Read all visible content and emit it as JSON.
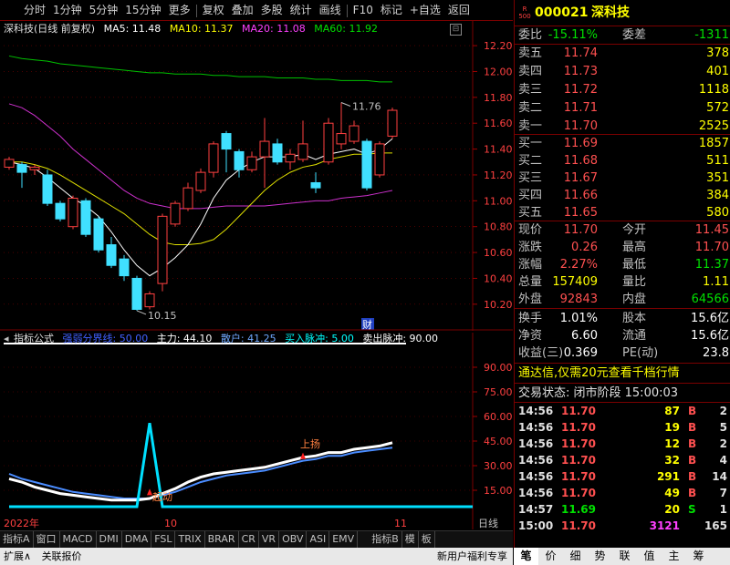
{
  "toolbar": {
    "items": [
      "分时",
      "1分钟",
      "5分钟",
      "15分钟",
      "更多",
      "复权",
      "叠加",
      "多股",
      "统计",
      "画线",
      "F10",
      "标记",
      "+自选",
      "返回"
    ]
  },
  "chart": {
    "stock_title": "深科技(日线 前复权)",
    "ma5": "MA5: 11.48",
    "ma10": "MA10: 11.37",
    "ma20": "MA20: 11.08",
    "ma60": "MA60: 11.92",
    "price_ticks": [
      "12.20",
      "12.00",
      "11.80",
      "11.60",
      "11.40",
      "11.20",
      "11.00",
      "10.80",
      "10.60",
      "10.40",
      "10.20"
    ],
    "high_label": "11.76",
    "low_label": "10.15",
    "cai_marker": "财",
    "date_labels": [
      "2022年",
      "10",
      "11"
    ],
    "period_label": "日线"
  },
  "indicator": {
    "name": "指标公式",
    "strength": "强弱分界线: 50.00",
    "main_force": "主力: 44.10",
    "retail": "散户: 41.25",
    "buy_pulse": "买入脉冲: 5.00",
    "sell_pulse": "卖出脉冲: 90.00",
    "ticks": [
      "90.00",
      "75.00",
      "60.00",
      "45.00",
      "30.00",
      "15.00"
    ],
    "ann_start": "起动",
    "ann_rise": "上扬"
  },
  "chart_data": {
    "type": "candlestick",
    "ylim": [
      10.1,
      12.25
    ],
    "candles": [
      {
        "o": 11.26,
        "c": 11.32,
        "h": 11.34,
        "l": 11.24
      },
      {
        "o": 11.28,
        "c": 11.22,
        "h": 11.3,
        "l": 11.1
      },
      {
        "o": 11.24,
        "c": 11.26,
        "h": 11.28,
        "l": 11.2
      },
      {
        "o": 11.2,
        "c": 10.98,
        "h": 11.24,
        "l": 10.96
      },
      {
        "o": 10.98,
        "c": 10.86,
        "h": 11.0,
        "l": 10.84
      },
      {
        "o": 10.8,
        "c": 11.02,
        "h": 11.04,
        "l": 10.78
      },
      {
        "o": 11.0,
        "c": 10.74,
        "h": 11.02,
        "l": 10.72
      },
      {
        "o": 10.86,
        "c": 10.62,
        "h": 10.88,
        "l": 10.6
      },
      {
        "o": 10.66,
        "c": 10.5,
        "h": 10.72,
        "l": 10.48
      },
      {
        "o": 10.55,
        "c": 10.42,
        "h": 10.58,
        "l": 10.38
      },
      {
        "o": 10.4,
        "c": 10.16,
        "h": 10.42,
        "l": 10.15
      },
      {
        "o": 10.18,
        "c": 10.28,
        "h": 10.3,
        "l": 10.16
      },
      {
        "o": 10.36,
        "c": 10.88,
        "h": 10.9,
        "l": 10.3
      },
      {
        "o": 10.82,
        "c": 10.98,
        "h": 11.0,
        "l": 10.8
      },
      {
        "o": 10.94,
        "c": 11.1,
        "h": 11.14,
        "l": 10.92
      },
      {
        "o": 11.08,
        "c": 11.22,
        "h": 11.25,
        "l": 11.06
      },
      {
        "o": 11.22,
        "c": 11.44,
        "h": 11.46,
        "l": 11.18
      },
      {
        "o": 11.52,
        "c": 11.4,
        "h": 11.54,
        "l": 11.22
      },
      {
        "o": 11.38,
        "c": 11.24,
        "h": 11.4,
        "l": 11.18
      },
      {
        "o": 11.24,
        "c": 11.34,
        "h": 11.38,
        "l": 11.22
      },
      {
        "o": 11.34,
        "c": 11.46,
        "h": 11.64,
        "l": 11.1
      },
      {
        "o": 11.44,
        "c": 11.3,
        "h": 11.48,
        "l": 11.28
      },
      {
        "o": 11.3,
        "c": 11.36,
        "h": 11.4,
        "l": 11.24
      },
      {
        "o": 11.32,
        "c": 11.44,
        "h": 11.62,
        "l": 11.3
      },
      {
        "o": 11.14,
        "c": 11.1,
        "h": 11.22,
        "l": 11.06
      },
      {
        "o": 11.3,
        "c": 11.6,
        "h": 11.64,
        "l": 11.28
      },
      {
        "o": 11.44,
        "c": 11.52,
        "h": 11.76,
        "l": 11.4
      },
      {
        "o": 11.46,
        "c": 11.58,
        "h": 11.62,
        "l": 11.44
      },
      {
        "o": 11.46,
        "c": 11.1,
        "h": 11.48,
        "l": 11.08
      },
      {
        "o": 11.2,
        "c": 11.44,
        "h": 11.46,
        "l": 11.18
      },
      {
        "o": 11.5,
        "c": 11.7,
        "h": 11.72,
        "l": 11.48
      }
    ],
    "ma5": [
      11.3,
      11.28,
      11.25,
      11.18,
      11.1,
      11.02,
      10.96,
      10.88,
      10.76,
      10.62,
      10.5,
      10.42,
      10.48,
      10.56,
      10.66,
      10.82,
      11.02,
      11.16,
      11.24,
      11.3,
      11.34,
      11.34,
      11.34,
      11.36,
      11.32,
      11.36,
      11.38,
      11.4,
      11.36,
      11.4,
      11.48
    ],
    "ma10": [
      11.3,
      11.3,
      11.28,
      11.25,
      11.2,
      11.14,
      11.08,
      11.02,
      10.96,
      10.9,
      10.82,
      10.74,
      10.68,
      10.66,
      10.66,
      10.67,
      10.7,
      10.78,
      10.88,
      10.98,
      11.08,
      11.16,
      11.22,
      11.26,
      11.28,
      11.32,
      11.34,
      11.36,
      11.36,
      11.37,
      11.37
    ],
    "ma20": [
      11.75,
      11.72,
      11.66,
      11.58,
      11.5,
      11.4,
      11.32,
      11.24,
      11.16,
      11.08,
      11.02,
      10.98,
      10.96,
      10.94,
      10.94,
      10.94,
      10.95,
      10.96,
      10.96,
      10.96,
      10.96,
      10.97,
      10.98,
      10.99,
      11.0,
      11.0,
      11.02,
      11.03,
      11.04,
      11.06,
      11.08
    ],
    "ma60": [
      12.12,
      12.1,
      12.09,
      12.08,
      12.06,
      12.05,
      12.04,
      12.03,
      12.02,
      12.01,
      12.0,
      11.99,
      11.99,
      11.98,
      11.98,
      11.98,
      11.97,
      11.97,
      11.96,
      11.96,
      11.96,
      11.95,
      11.95,
      11.95,
      11.94,
      11.94,
      11.93,
      11.93,
      11.93,
      11.92,
      11.92
    ],
    "indicator_ylim": [
      0,
      100
    ],
    "main_force_series": [
      22,
      20,
      17,
      15,
      13,
      12,
      11,
      10,
      9,
      9,
      9,
      10,
      13,
      16,
      20,
      23,
      25,
      26,
      27,
      28,
      29,
      31,
      33,
      35,
      36,
      38,
      38,
      40,
      41,
      42,
      44
    ],
    "retail_series": [
      25,
      22,
      20,
      18,
      16,
      14,
      13,
      12,
      11,
      10,
      10,
      10,
      12,
      14,
      17,
      20,
      22,
      24,
      25,
      26,
      27,
      29,
      31,
      33,
      34,
      36,
      36,
      38,
      39,
      40,
      41
    ],
    "pulse_series": [
      5,
      5,
      5,
      5,
      5,
      5,
      5,
      5,
      5,
      5,
      5,
      5,
      5,
      5,
      5,
      5,
      5,
      5,
      5,
      5,
      5,
      5,
      5,
      5,
      5,
      5,
      5,
      5,
      5,
      5,
      5
    ],
    "spike": {
      "index": 11,
      "value": 56
    }
  },
  "quote": {
    "code": "000021",
    "name": "深科技",
    "weibi_label": "委比",
    "weibi": "-15.11%",
    "weicha_label": "委差",
    "weicha": "-1311",
    "asks": [
      {
        "label": "卖五",
        "price": "11.74",
        "vol": "378"
      },
      {
        "label": "卖四",
        "price": "11.73",
        "vol": "401"
      },
      {
        "label": "卖三",
        "price": "11.72",
        "vol": "1118"
      },
      {
        "label": "卖二",
        "price": "11.71",
        "vol": "572"
      },
      {
        "label": "卖一",
        "price": "11.70",
        "vol": "2525"
      }
    ],
    "bids": [
      {
        "label": "买一",
        "price": "11.69",
        "vol": "1857"
      },
      {
        "label": "买二",
        "price": "11.68",
        "vol": "511"
      },
      {
        "label": "买三",
        "price": "11.67",
        "vol": "351"
      },
      {
        "label": "买四",
        "price": "11.66",
        "vol": "384"
      },
      {
        "label": "买五",
        "price": "11.65",
        "vol": "580"
      }
    ],
    "stats1": [
      {
        "l1": "现价",
        "v1": "11.70",
        "l2": "今开",
        "v2": "11.45",
        "c1": "red",
        "c2": "red"
      },
      {
        "l1": "涨跌",
        "v1": "0.26",
        "l2": "最高",
        "v2": "11.70",
        "c1": "red",
        "c2": "red"
      },
      {
        "l1": "涨幅",
        "v1": "2.27%",
        "l2": "最低",
        "v2": "11.37",
        "c1": "red",
        "c2": "green"
      },
      {
        "l1": "总量",
        "v1": "157409",
        "l2": "量比",
        "v2": "1.11",
        "c1": "yellow",
        "c2": "yellow"
      },
      {
        "l1": "外盘",
        "v1": "92843",
        "l2": "内盘",
        "v2": "64566",
        "c1": "red",
        "c2": "green"
      }
    ],
    "stats2": [
      {
        "l1": "换手",
        "v1": "1.01%",
        "l2": "股本",
        "v2": "15.6亿"
      },
      {
        "l1": "净资",
        "v1": "6.60",
        "l2": "流通",
        "v2": "15.6亿"
      },
      {
        "l1": "收益(三)",
        "v1": "0.369",
        "l2": "PE(动)",
        "v2": "23.8"
      }
    ],
    "ad": "通达信,仅需20元查看千档行情",
    "trade_status": "交易状态: 闭市阶段 15:00:03",
    "ticks": [
      {
        "t": "14:56",
        "p": "11.70",
        "v": "87",
        "s": "B",
        "n": "2"
      },
      {
        "t": "14:56",
        "p": "11.70",
        "v": "19",
        "s": "B",
        "n": "5"
      },
      {
        "t": "14:56",
        "p": "11.70",
        "v": "12",
        "s": "B",
        "n": "2"
      },
      {
        "t": "14:56",
        "p": "11.70",
        "v": "32",
        "s": "B",
        "n": "4"
      },
      {
        "t": "14:56",
        "p": "11.70",
        "v": "291",
        "s": "B",
        "n": "14"
      },
      {
        "t": "14:56",
        "p": "11.70",
        "v": "49",
        "s": "B",
        "n": "7"
      },
      {
        "t": "14:57",
        "p": "11.69",
        "v": "20",
        "s": "S",
        "n": "1"
      },
      {
        "t": "15:00",
        "p": "11.70",
        "v": "3121",
        "s": "",
        "n": "165"
      }
    ],
    "footer_tabs": [
      "笔",
      "价",
      "细",
      "势",
      "联",
      "值",
      "主",
      "筹"
    ]
  },
  "bottom_tabs": [
    "指标A",
    "窗口",
    "MACD",
    "DMI",
    "DMA",
    "FSL",
    "TRIX",
    "BRAR",
    "CR",
    "VR",
    "OBV",
    "ASI",
    "EMV",
    "指标B",
    "模",
    "板"
  ],
  "status_bar": {
    "expand": "扩展∧",
    "link": "关联报价",
    "promo": "新用户福利专享"
  }
}
